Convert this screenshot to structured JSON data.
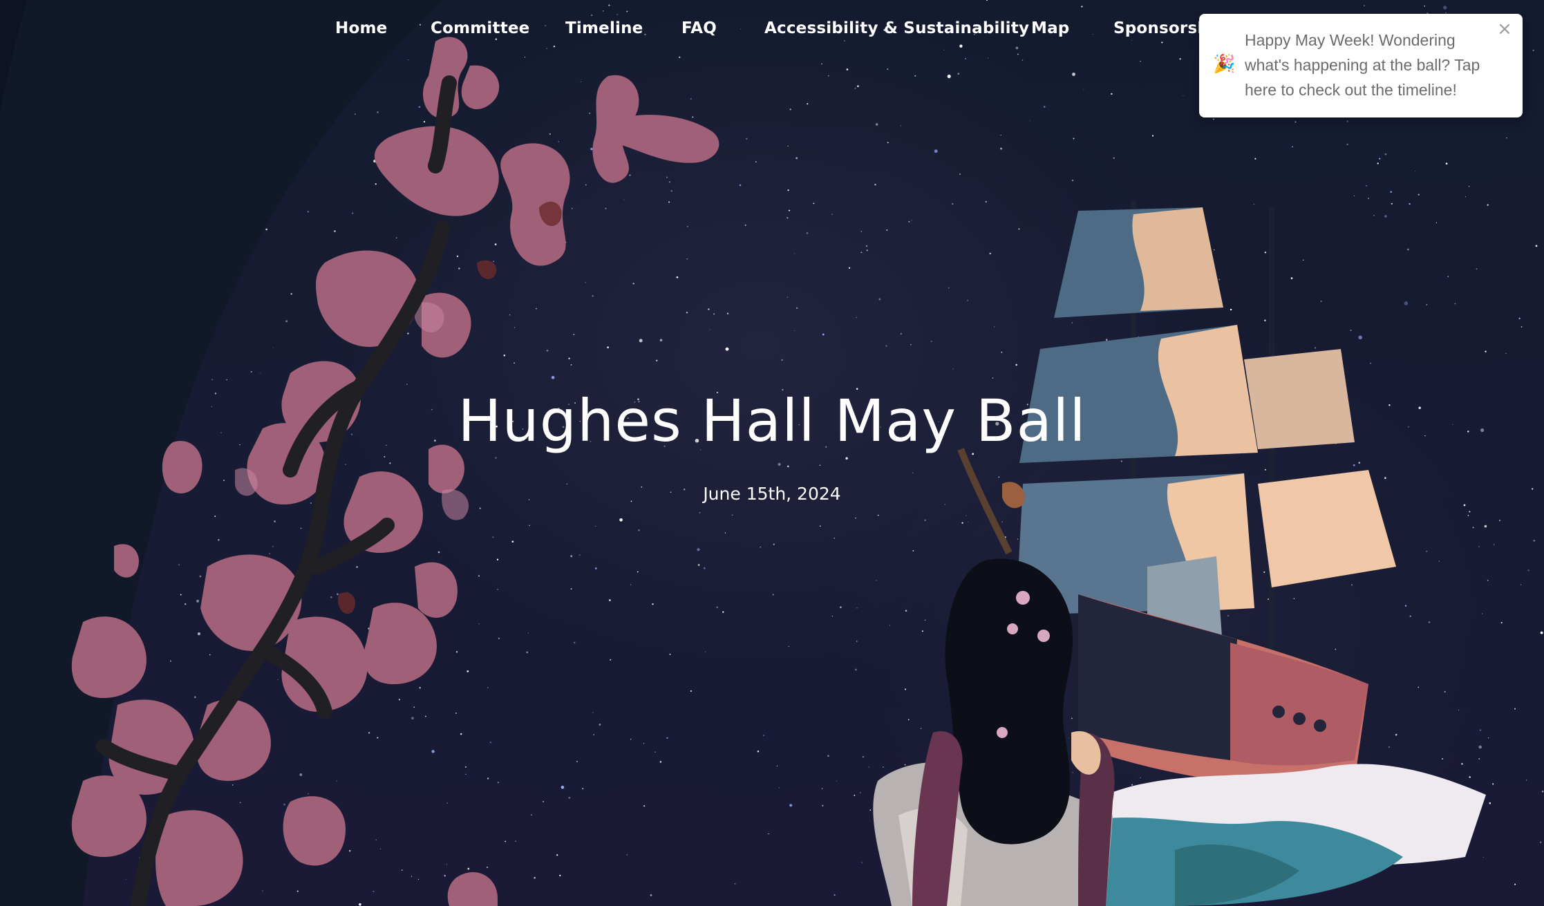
{
  "nav": {
    "items": [
      {
        "label": "Home"
      },
      {
        "label": "Committee"
      },
      {
        "label": "Timeline"
      },
      {
        "label": "FAQ"
      },
      {
        "label": "Accessibility & Sustainability"
      },
      {
        "label": "Map"
      },
      {
        "label": "Sponsorshi"
      }
    ]
  },
  "hero": {
    "title": "Hughes Hall May Ball",
    "date": "June 15th, 2024"
  },
  "toast": {
    "icon": "party-popper-icon",
    "emoji": "🎉",
    "message": "Happy May Week! Wondering what's happening at the ball? Tap here to check out the timeline!",
    "close_symbol": "×"
  },
  "colors": {
    "background": "#141b2f",
    "blossom": "#a86580",
    "sail_blue": "#4e6b86",
    "sail_peach": "#e8c0a0",
    "hull_red": "#c8706a",
    "text": "#ffffff",
    "toast_text": "#6b6b6b"
  }
}
